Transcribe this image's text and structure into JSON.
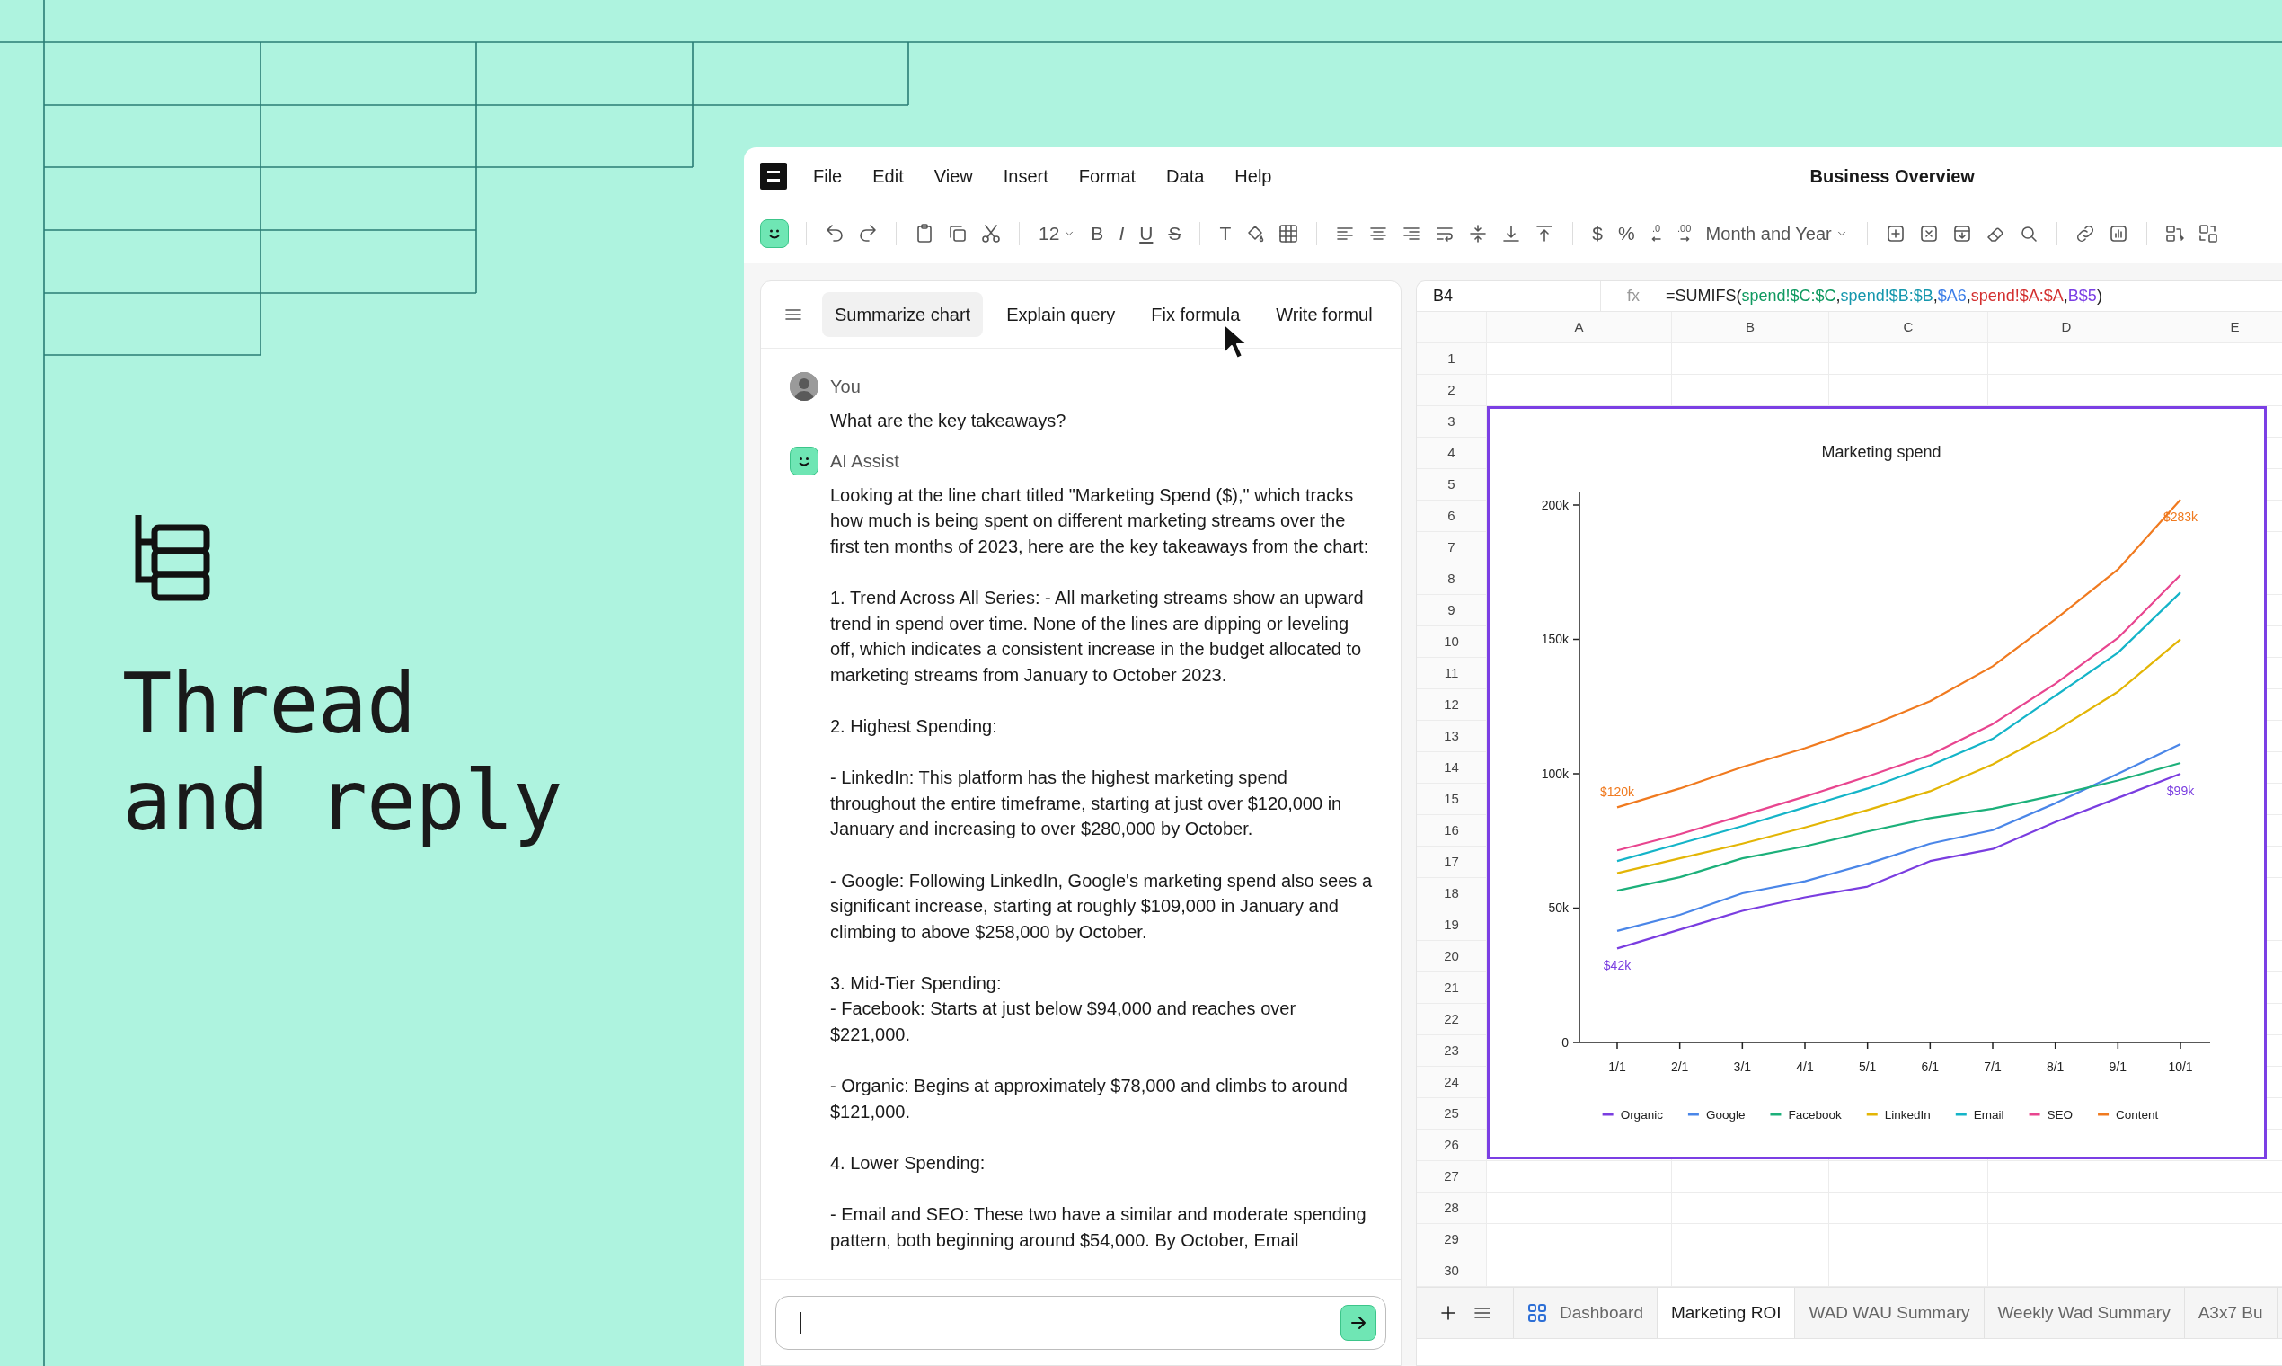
{
  "hero": {
    "headline": "Thread and reply"
  },
  "app": {
    "menu": [
      "File",
      "Edit",
      "View",
      "Insert",
      "Format",
      "Data",
      "Help"
    ],
    "document_title": "Business Overview",
    "toolbar": {
      "font_size": "12",
      "text_styles": [
        "B",
        "I",
        "U",
        "S"
      ],
      "text_tool": "T",
      "currency": "$",
      "percent": "%",
      "decrease_decimals": ".0",
      "increase_decimals": ".00",
      "number_format": "Month and Year"
    },
    "assistant": {
      "chips": [
        {
          "label": "Summarize chart",
          "selected": true
        },
        {
          "label": "Explain query",
          "selected": false
        },
        {
          "label": "Fix formula",
          "selected": false
        },
        {
          "label": "Write formul",
          "selected": false
        }
      ],
      "messages": [
        {
          "kind": "user",
          "author": "You",
          "blocks": [
            [
              "What are the key takeaways?"
            ]
          ]
        },
        {
          "kind": "assistant",
          "author": "AI Assist",
          "blocks": [
            [
              "Looking at the line chart titled \"Marketing Spend ($),\" which tracks how much is being spent on different marketing streams over the first ten months of 2023, here are the key takeaways from the chart:"
            ],
            [
              "1. Trend Across All Series: - All marketing streams show an upward trend in spend over time. None of the lines are dipping or leveling off, which indicates a consistent increase in the budget allocated to marketing streams from January to October 2023."
            ],
            [
              "2. Highest Spending:"
            ],
            [
              "- LinkedIn: This platform has the highest marketing spend throughout the entire timeframe, starting at just over $120,000 in January and increasing to over $280,000 by October."
            ],
            [
              "- Google: Following LinkedIn, Google's marketing spend also sees a significant increase, starting at roughly $109,000 in January and climbing to above $258,000 by October."
            ],
            [
              "3. Mid-Tier Spending:",
              "- Facebook: Starts at just below $94,000 and reaches over $221,000."
            ],
            [
              "- Organic: Begins at approximately $78,000 and climbs to around $121,000."
            ],
            [
              "4. Lower Spending:"
            ],
            [
              "- Email and SEO: These two have a similar and moderate spending pattern, both beginning around $54,000. By October, Email"
            ]
          ]
        }
      ]
    },
    "sheet": {
      "cell_ref": "B4",
      "fx_label": "fx",
      "formula_parts": [
        {
          "text": "=SUMIFS(",
          "color": "#222222"
        },
        {
          "text": "spend!$C:$C",
          "color": "#0f9960"
        },
        {
          "text": ","
        },
        {
          "text": "spend!$B:$B",
          "color": "#1597ad"
        },
        {
          "text": ","
        },
        {
          "text": "$A6",
          "color": "#3b7ee8"
        },
        {
          "text": ","
        },
        {
          "text": "spend!$A:$A",
          "color": "#d32f2f"
        },
        {
          "text": ","
        },
        {
          "text": "B$5",
          "color": "#7b3fe4"
        },
        {
          "text": ")",
          "color": "#222222"
        }
      ],
      "columns": [
        "A",
        "B",
        "C",
        "D",
        "E"
      ],
      "rows": [
        "1",
        "2",
        "3",
        "4",
        "5",
        "6",
        "7",
        "8",
        "9",
        "10",
        "11",
        "12",
        "13",
        "14",
        "15",
        "16",
        "17",
        "18",
        "19",
        "20",
        "21",
        "22",
        "23",
        "24",
        "25",
        "26",
        "27",
        "28",
        "29",
        "30"
      ],
      "chart": {
        "chart_data": {
          "type": "line",
          "title": "Marketing spend",
          "categories": [
            "1/1",
            "2/1",
            "3/1",
            "4/1",
            "5/1",
            "6/1",
            "7/1",
            "8/1",
            "9/1",
            "10/1"
          ],
          "ylim": [
            0,
            205
          ],
          "yticks": [
            {
              "value": 0,
              "label": "0"
            },
            {
              "value": 50,
              "label": "50k"
            },
            {
              "value": 100,
              "label": "100k"
            },
            {
              "value": 150,
              "label": "150k"
            },
            {
              "value": 200,
              "label": "200k"
            }
          ],
          "series": [
            {
              "name": "Organic",
              "color": "#7a3de0",
              "values": [
                35,
                42,
                49,
                54,
                58,
                67.5,
                72,
                82,
                91,
                100
              ]
            },
            {
              "name": "Google",
              "color": "#4a86e8",
              "values": [
                41.5,
                47.5,
                55.5,
                60,
                66.5,
                74,
                79,
                89,
                100,
                111
              ]
            },
            {
              "name": "Facebook",
              "color": "#1cb07a",
              "values": [
                56.5,
                61.5,
                68.5,
                73,
                78.5,
                83.5,
                87,
                92,
                97.5,
                104
              ]
            },
            {
              "name": "LinkedIn",
              "color": "#e3b505",
              "values": [
                63,
                68.5,
                74,
                80,
                86.5,
                93.5,
                103.5,
                116,
                130.5,
                150
              ]
            },
            {
              "name": "Email",
              "color": "#14b4c8",
              "values": [
                67.5,
                74,
                80.5,
                87.5,
                94.5,
                103,
                113,
                129,
                145,
                167.5
              ]
            },
            {
              "name": "SEO",
              "color": "#e8458f",
              "values": [
                71.5,
                77.5,
                84.5,
                91.5,
                99,
                107,
                118.5,
                133.5,
                150.5,
                174
              ]
            },
            {
              "name": "Content",
              "color": "#f07a1f",
              "values": [
                87.5,
                94.5,
                102.5,
                109.5,
                117.5,
                127,
                140,
                157.5,
                176,
                202
              ]
            }
          ],
          "legend": "bottom",
          "annotations": [
            "$283k",
            "$120k",
            "$42k",
            "$99k"
          ]
        }
      },
      "tabs": [
        {
          "label": "Dashboard",
          "kind": "dashboard",
          "selected": false
        },
        {
          "label": "Marketing ROI",
          "kind": "sheet",
          "selected": true
        },
        {
          "label": "WAD WAU Summary",
          "kind": "sheet",
          "selected": false
        },
        {
          "label": "Weekly Wad Summary",
          "kind": "sheet",
          "selected": false
        },
        {
          "label": "A3x7 Bu",
          "kind": "sheet",
          "selected": false
        }
      ]
    }
  }
}
